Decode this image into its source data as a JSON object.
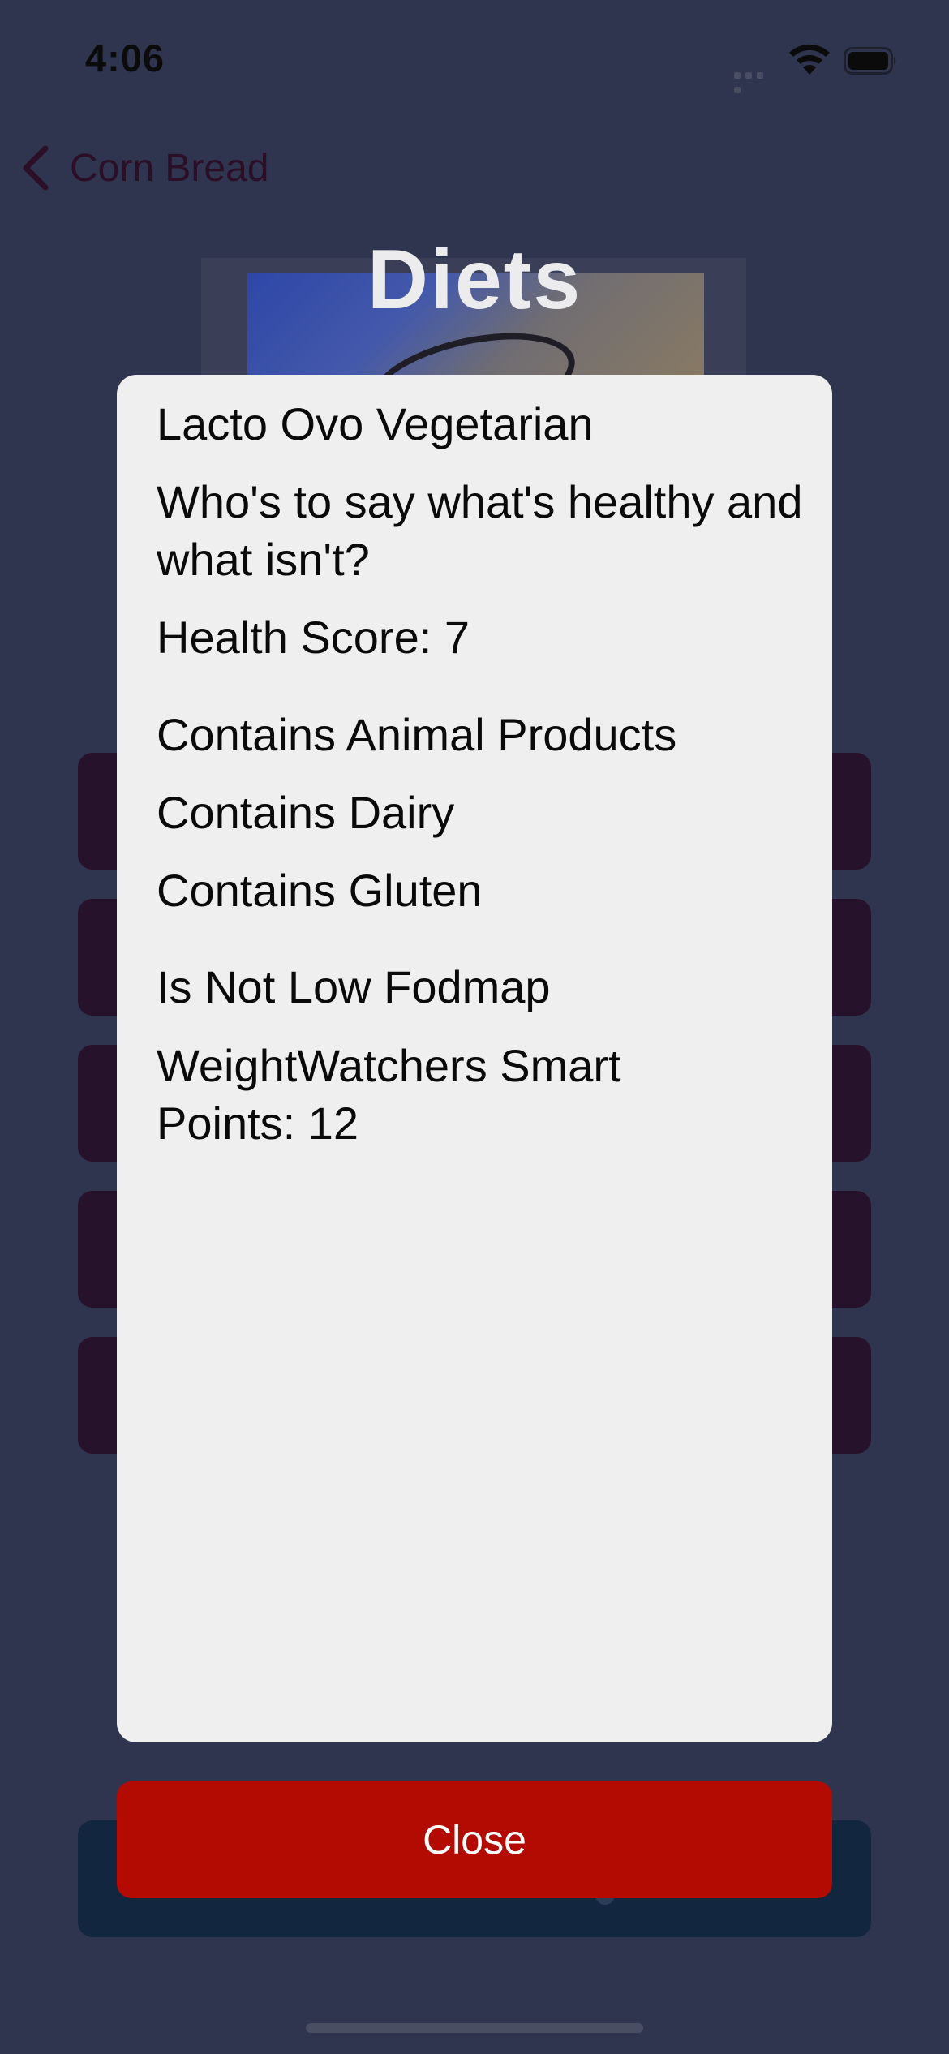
{
  "status_bar": {
    "time": "4:06"
  },
  "nav": {
    "back_label": "Corn Bread"
  },
  "page": {
    "title": "Diets"
  },
  "modal": {
    "lines": [
      "Lacto Ovo Vegetarian",
      "Who's to say what's healthy and what isn't?",
      "Health Score: 7",
      "Contains Animal Products",
      "Contains Dairy",
      "Contains Gluten",
      "Is Not Low Fodmap",
      "WeightWatchers Smart Points: 12"
    ]
  },
  "buttons": {
    "close_label": "Close"
  },
  "colors": {
    "background": "#30354f",
    "modal_background": "#efefef",
    "close_button": "#b30a02",
    "background_buttons": "#26122a"
  }
}
